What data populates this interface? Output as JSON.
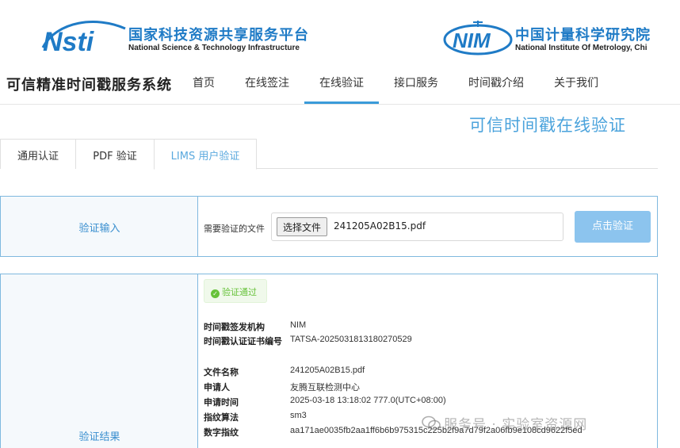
{
  "header": {
    "nsti_name_cn": "国家科技资源共享服务平台",
    "nsti_name_en": "National Science & Technology Infrastructure",
    "nim_name_cn": "中国计量科学研究院",
    "nim_name_en": "National Institute Of Metrology, Chi",
    "nsti_logo_text": "Nsti",
    "nim_logo_text": "NIM"
  },
  "nav": {
    "system_title": "可信精准时间戳服务系统",
    "items": [
      "首页",
      "在线签注",
      "在线验证",
      "接口服务",
      "时间戳介绍",
      "关于我们"
    ],
    "active": "在线验证"
  },
  "page": {
    "heading": "可信时间戳在线验证"
  },
  "tabs": [
    "通用认证",
    "PDF 验证",
    "LIMS 用户验证"
  ],
  "active_tab": "LIMS 用户验证",
  "input_panel": {
    "label": "验证输入",
    "file_label": "需要验证的文件",
    "choose_button": "选择文件",
    "file_name": "241205A02B15.pdf",
    "verify_button": "点击验证"
  },
  "result_panel": {
    "label": "验证结果",
    "status": "验证通过",
    "rows": [
      {
        "label": "时间戳签发机构",
        "value": "NIM"
      },
      {
        "label": "时间戳认证证书编号",
        "value": "TATSA-2025031813180270529"
      },
      {
        "label": "文件名称",
        "value": "241205A02B15.pdf"
      },
      {
        "label": "申请人",
        "value": "友腾互联检测中心"
      },
      {
        "label": "申请时间",
        "value": "2025-03-18 13:18:02 777.0(UTC+08:00)"
      },
      {
        "label": "指纹算法",
        "value": "sm3"
      },
      {
        "label": "数字指纹",
        "value": "aa171ae0035fb2aa1ff6b6b975315c225b2f9a7d79f2a06fb9e108cd9622f5ed"
      }
    ]
  },
  "watermark": "服务号 · 实验室资源网",
  "colors": {
    "brand_blue": "#1f7bc6",
    "accent": "#3a9bd9",
    "panel_border": "#7fb9df",
    "button": "#8cc4ee",
    "success": "#67c23a"
  }
}
